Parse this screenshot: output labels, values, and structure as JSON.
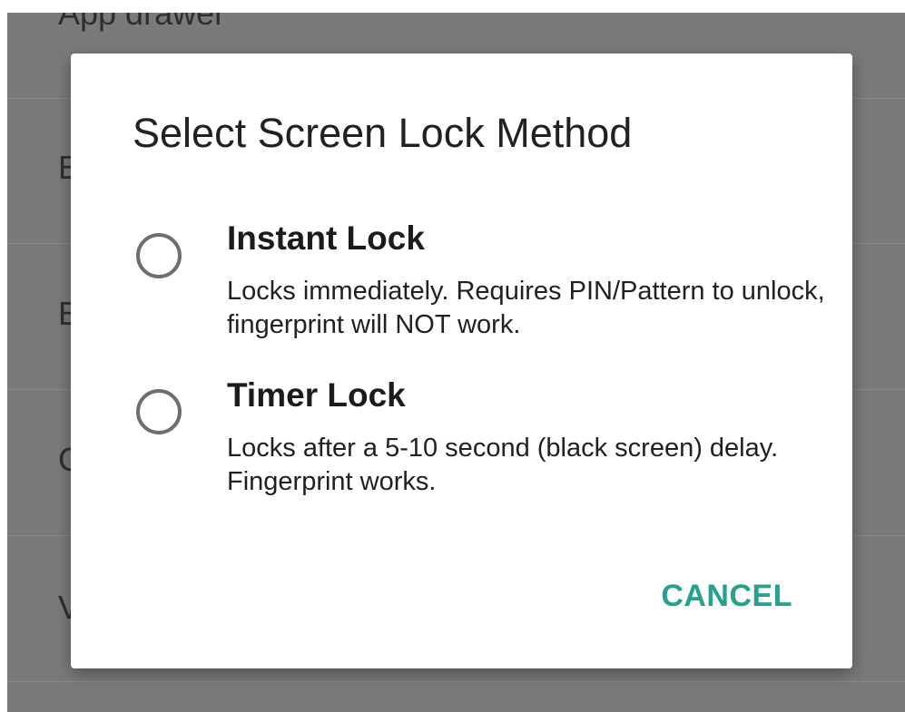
{
  "background": {
    "rows": [
      {
        "label": "App drawer"
      },
      {
        "label": "E"
      },
      {
        "label": "E"
      },
      {
        "label": "C"
      },
      {
        "label": "V"
      }
    ]
  },
  "dialog": {
    "title": "Select Screen Lock Method",
    "options": [
      {
        "title": "Instant Lock",
        "description": "Locks immediately. Requires PIN/Pattern to unlock, fingerprint will NOT work.",
        "selected": false
      },
      {
        "title": "Timer Lock",
        "description": "Locks after a 5-10 second (black screen) delay. Fingerprint works.",
        "selected": false
      }
    ],
    "cancel_label": "CANCEL"
  },
  "colors": {
    "accent": "#26a18c",
    "scrim": "#7a7a7a",
    "radio_border": "#6e6e6e"
  },
  "icons": {
    "radio": "radio-unchecked-icon"
  }
}
